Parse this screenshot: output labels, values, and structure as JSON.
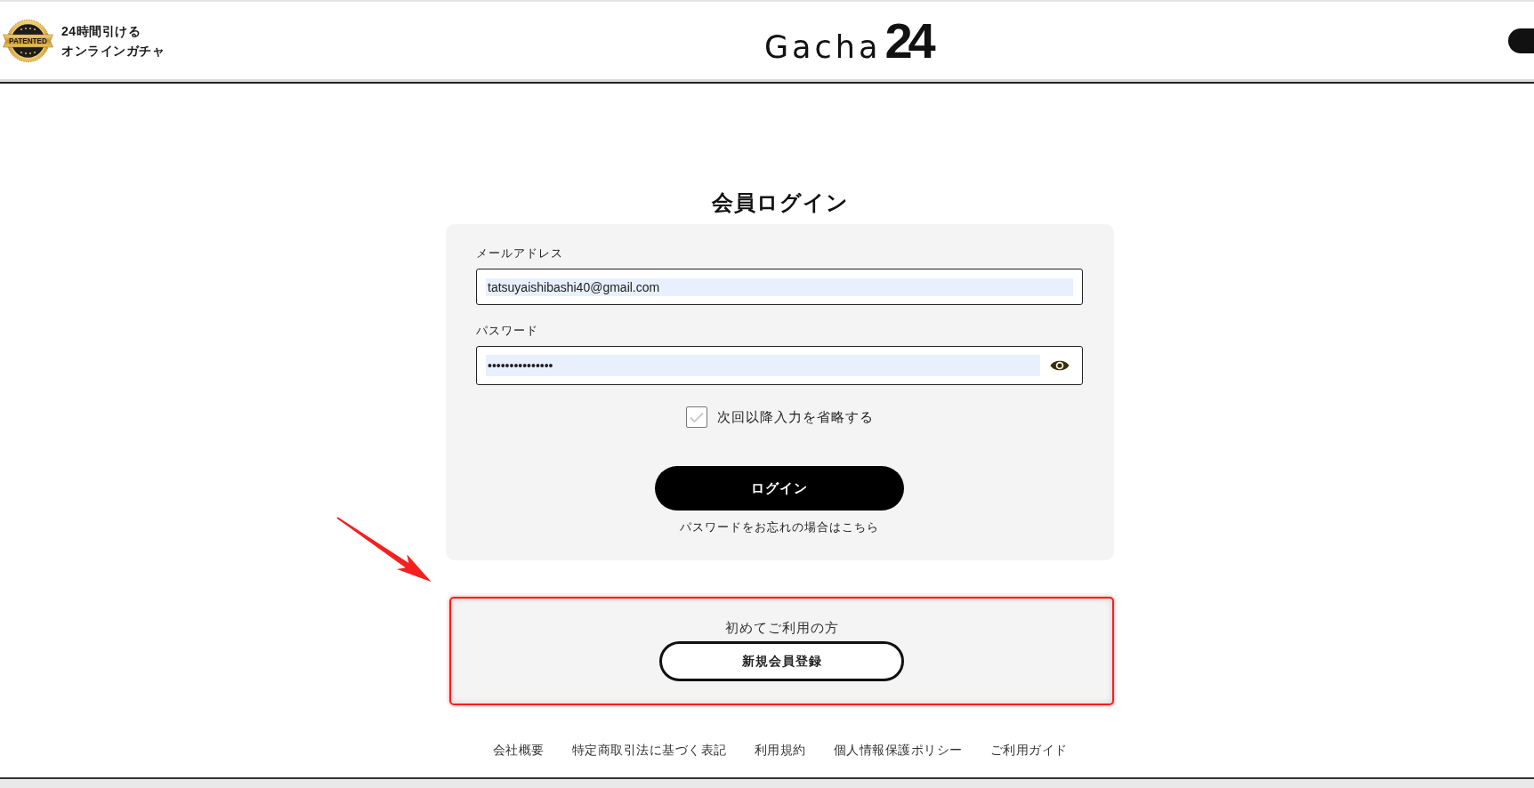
{
  "header": {
    "badge": "PATENTED",
    "tagline": [
      "24時間引ける",
      "オンラインガチャ"
    ],
    "logo": "Gacha**24**"
  },
  "login": {
    "title": "会員ログイン",
    "fields": [
      {
        "kind": "email",
        "label": "メールアドレス",
        "value": "tatsuyaishibashi40@gmail.com",
        "autofilled": true
      },
      {
        "kind": "password",
        "label": "パスワード",
        "value": "•••••••••••••••",
        "autofilled": true
      }
    ],
    "remember": {
      "label": "次回以降入力を省略する",
      "checked": false
    },
    "submit": "ログイン",
    "forgot_link": "パスワードをお忘れの場合はこちら"
  },
  "signup": {
    "text": "初めてご利用の方",
    "button": "新規会員登録",
    "highlighted": true
  },
  "footer_links": [
    "会社概要",
    "特定商取引法に基づく表記",
    "利用規約",
    "個人情報保護ポリシー",
    "ご利用ガイド"
  ]
}
